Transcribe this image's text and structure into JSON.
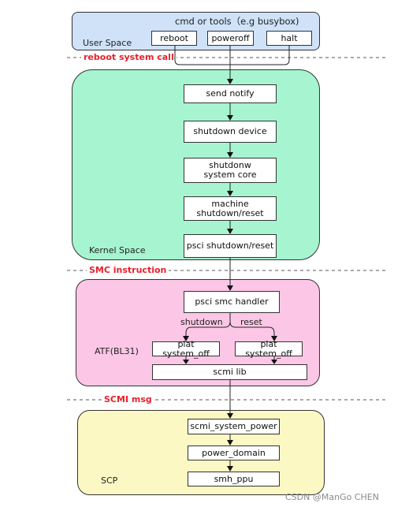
{
  "user_space": {
    "label": "User Space",
    "title": "cmd or tools（e.g busybox)",
    "commands": [
      "reboot",
      "poweroff",
      "halt"
    ],
    "color": "#cfe2f8"
  },
  "separators": {
    "syscall": "reboot system call",
    "smc": "SMC instruction",
    "scmi": "SCMI msg",
    "color": "#e8202a"
  },
  "kernel_space": {
    "label": "Kernel Space",
    "steps": [
      "send notify",
      "shutdown device",
      "shutdonw system core",
      "machine shutdown/reset",
      "psci shutdown/reset"
    ],
    "color": "#a6f5d0"
  },
  "atf": {
    "label": "ATF(BL31)",
    "handler": "psci smc handler",
    "branch_left": "shutdown",
    "branch_right": "reset",
    "left_box": "plat system_off",
    "right_box": "plat system_off",
    "lib": "scmi lib",
    "color": "#fcc7e6"
  },
  "scp": {
    "label": "SCP",
    "steps": [
      "scmi_system_power",
      "power_domain",
      "smh_ppu"
    ],
    "color": "#fbf8c3"
  },
  "watermark": "CSDN @ManGo CHEN"
}
